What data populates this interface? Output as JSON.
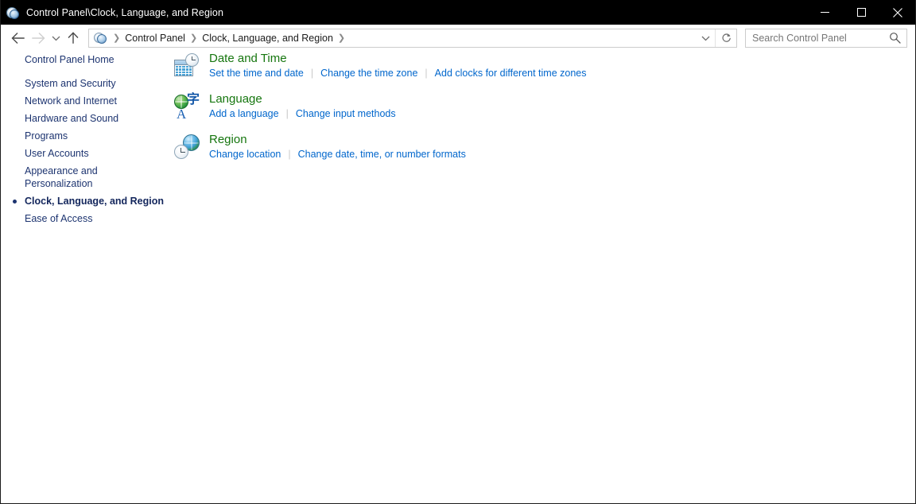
{
  "window": {
    "title": "Control Panel\\Clock, Language, and Region",
    "icon": "control-panel-icon",
    "minimize_label": "Minimize",
    "maximize_label": "Maximize",
    "close_label": "Close"
  },
  "nav": {
    "back_label": "Back",
    "forward_label": "Forward",
    "recent_label": "Recent locations",
    "up_label": "Up one level",
    "address_chevron_label": "Previous locations",
    "refresh_label": "Refresh",
    "breadcrumb": [
      {
        "label": "Control Panel"
      },
      {
        "label": "Clock, Language, and Region"
      }
    ],
    "breadcrumb_separator": "❯"
  },
  "search": {
    "placeholder": "Search Control Panel",
    "value": "",
    "icon": "search-icon"
  },
  "sidebar": {
    "home": {
      "label": "Control Panel Home"
    },
    "items": [
      {
        "label": "System and Security",
        "active": false
      },
      {
        "label": "Network and Internet",
        "active": false
      },
      {
        "label": "Hardware and Sound",
        "active": false
      },
      {
        "label": "Programs",
        "active": false
      },
      {
        "label": "User Accounts",
        "active": false
      },
      {
        "label": "Appearance and\nPersonalization",
        "active": false
      },
      {
        "label": "Clock, Language, and Region",
        "active": true
      },
      {
        "label": "Ease of Access",
        "active": false
      }
    ]
  },
  "main": {
    "categories": [
      {
        "title": "Date and Time",
        "icon": "date-and-time-icon",
        "links": [
          "Set the time and date",
          "Change the time zone",
          "Add clocks for different time zones"
        ]
      },
      {
        "title": "Language",
        "icon": "language-icon",
        "links": [
          "Add a language",
          "Change input methods"
        ]
      },
      {
        "title": "Region",
        "icon": "region-icon",
        "links": [
          "Change location",
          "Change date, time, or number formats"
        ]
      }
    ],
    "link_separator": "|"
  },
  "colors": {
    "titlebar_bg": "#000000",
    "titlebar_text": "#ffffff",
    "category_heading": "#16760f",
    "link": "#0066cc",
    "sidebar_text": "#1d3470",
    "window_bg": "#ffffff",
    "border": "#cccccc"
  }
}
